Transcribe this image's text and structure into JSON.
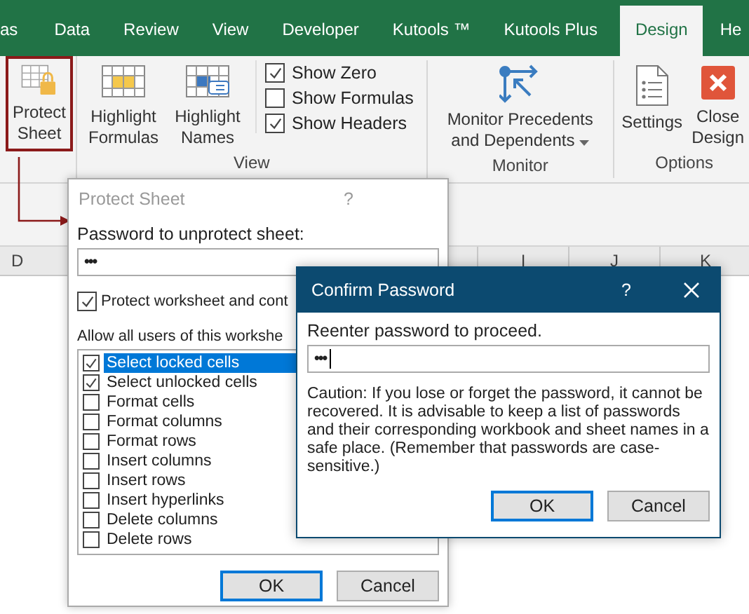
{
  "tabs": [
    {
      "label": "as",
      "selected": false
    },
    {
      "label": "Data",
      "selected": false
    },
    {
      "label": "Review",
      "selected": false
    },
    {
      "label": "View",
      "selected": false
    },
    {
      "label": "Developer",
      "selected": false
    },
    {
      "label": "Kutools ™",
      "selected": false
    },
    {
      "label": "Kutools Plus",
      "selected": false
    },
    {
      "label": "Design",
      "selected": true
    },
    {
      "label": "He",
      "selected": false
    }
  ],
  "ribbon": {
    "protect_sheet": "Protect Sheet",
    "view_group": {
      "label": "View",
      "highlight_formulas": "Highlight Formulas",
      "highlight_names": "Highlight Names",
      "options": [
        {
          "label": "Show Zero",
          "checked": true
        },
        {
          "label": "Show Formulas",
          "checked": false
        },
        {
          "label": "Show Headers",
          "checked": true
        }
      ]
    },
    "monitor_group": {
      "label": "Monitor",
      "button": "Monitor Precedents and Dependents"
    },
    "options_group": {
      "label": "Options",
      "settings": "Settings",
      "close_design": "Close Design"
    }
  },
  "column_headers": [
    "D",
    "I",
    "J",
    "K"
  ],
  "protect_dialog": {
    "title": "Protect Sheet",
    "help": "?",
    "password_label": "Password to unprotect sheet:",
    "password_value": "•••",
    "protect_option": {
      "label": "Protect worksheet and cont",
      "checked": true
    },
    "allow_label": "Allow all users of this workshe",
    "permissions": [
      {
        "label": "Select locked cells",
        "checked": true,
        "selected": true
      },
      {
        "label": "Select unlocked cells",
        "checked": true,
        "selected": false
      },
      {
        "label": "Format cells",
        "checked": false,
        "selected": false
      },
      {
        "label": "Format columns",
        "checked": false,
        "selected": false
      },
      {
        "label": "Format rows",
        "checked": false,
        "selected": false
      },
      {
        "label": "Insert columns",
        "checked": false,
        "selected": false
      },
      {
        "label": "Insert rows",
        "checked": false,
        "selected": false
      },
      {
        "label": "Insert hyperlinks",
        "checked": false,
        "selected": false
      },
      {
        "label": "Delete columns",
        "checked": false,
        "selected": false
      },
      {
        "label": "Delete rows",
        "checked": false,
        "selected": false
      }
    ],
    "buttons": [
      "OK",
      "Cancel"
    ]
  },
  "confirm_dialog": {
    "title": "Confirm Password",
    "help": "?",
    "prompt": "Reenter password to proceed.",
    "password_value": "•••",
    "caution": "Caution: If you lose or forget the password, it cannot be recovered. It is advisable to keep a list of passwords and their corresponding workbook and sheet names in a safe place.  (Remember that passwords are case-sensitive.)",
    "buttons": [
      "OK",
      "Cancel"
    ]
  }
}
